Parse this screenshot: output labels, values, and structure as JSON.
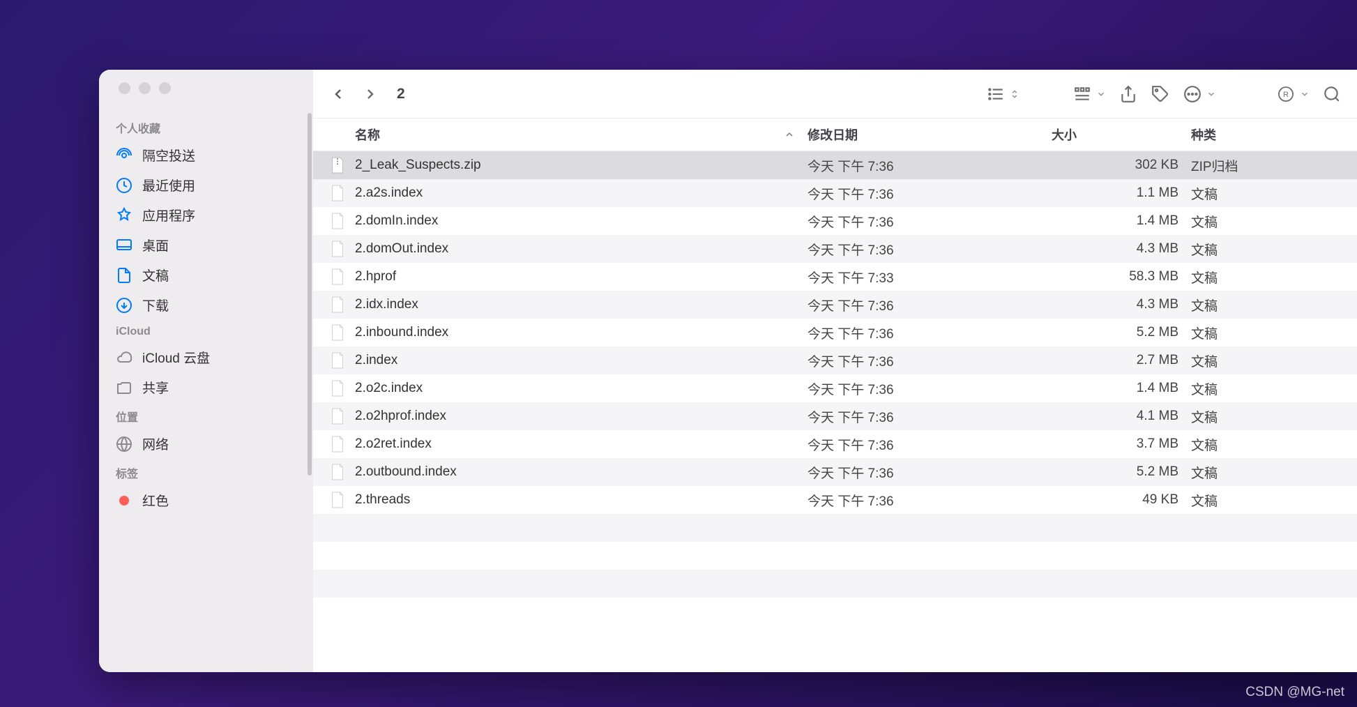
{
  "window_title": "2",
  "sidebar": {
    "sections": [
      {
        "label": "个人收藏",
        "items": [
          {
            "icon": "airdrop-icon",
            "label": "隔空投送"
          },
          {
            "icon": "clock-icon",
            "label": "最近使用"
          },
          {
            "icon": "apps-icon",
            "label": "应用程序"
          },
          {
            "icon": "desktop-icon",
            "label": "桌面"
          },
          {
            "icon": "doc-icon",
            "label": "文稿"
          },
          {
            "icon": "download-icon",
            "label": "下载"
          }
        ]
      },
      {
        "label": "iCloud",
        "items": [
          {
            "icon": "cloud-icon",
            "label": "iCloud 云盘"
          },
          {
            "icon": "shared-icon",
            "label": "共享"
          }
        ]
      },
      {
        "label": "位置",
        "items": [
          {
            "icon": "globe-icon",
            "label": "网络"
          }
        ]
      },
      {
        "label": "标签",
        "items": [
          {
            "icon": "red-tag",
            "label": "红色",
            "color": "#ff5f57"
          }
        ]
      }
    ]
  },
  "columns": {
    "name": "名称",
    "date": "修改日期",
    "size": "大小",
    "kind": "种类"
  },
  "files": [
    {
      "name": "2_Leak_Suspects.zip",
      "date": "今天 下午 7:36",
      "size": "302 KB",
      "kind": "ZIP归档",
      "icon": "zip",
      "selected": true
    },
    {
      "name": "2.a2s.index",
      "date": "今天 下午 7:36",
      "size": "1.1 MB",
      "kind": "文稿",
      "icon": "blank"
    },
    {
      "name": "2.domIn.index",
      "date": "今天 下午 7:36",
      "size": "1.4 MB",
      "kind": "文稿",
      "icon": "blank"
    },
    {
      "name": "2.domOut.index",
      "date": "今天 下午 7:36",
      "size": "4.3 MB",
      "kind": "文稿",
      "icon": "blank"
    },
    {
      "name": "2.hprof",
      "date": "今天 下午 7:33",
      "size": "58.3 MB",
      "kind": "文稿",
      "icon": "blank"
    },
    {
      "name": "2.idx.index",
      "date": "今天 下午 7:36",
      "size": "4.3 MB",
      "kind": "文稿",
      "icon": "blank"
    },
    {
      "name": "2.inbound.index",
      "date": "今天 下午 7:36",
      "size": "5.2 MB",
      "kind": "文稿",
      "icon": "blank"
    },
    {
      "name": "2.index",
      "date": "今天 下午 7:36",
      "size": "2.7 MB",
      "kind": "文稿",
      "icon": "blank"
    },
    {
      "name": "2.o2c.index",
      "date": "今天 下午 7:36",
      "size": "1.4 MB",
      "kind": "文稿",
      "icon": "blank"
    },
    {
      "name": "2.o2hprof.index",
      "date": "今天 下午 7:36",
      "size": "4.1 MB",
      "kind": "文稿",
      "icon": "blank"
    },
    {
      "name": "2.o2ret.index",
      "date": "今天 下午 7:36",
      "size": "3.7 MB",
      "kind": "文稿",
      "icon": "blank"
    },
    {
      "name": "2.outbound.index",
      "date": "今天 下午 7:36",
      "size": "5.2 MB",
      "kind": "文稿",
      "icon": "blank"
    },
    {
      "name": "2.threads",
      "date": "今天 下午 7:36",
      "size": "49 KB",
      "kind": "文稿",
      "icon": "blank"
    }
  ],
  "watermark": "CSDN @MG-net"
}
